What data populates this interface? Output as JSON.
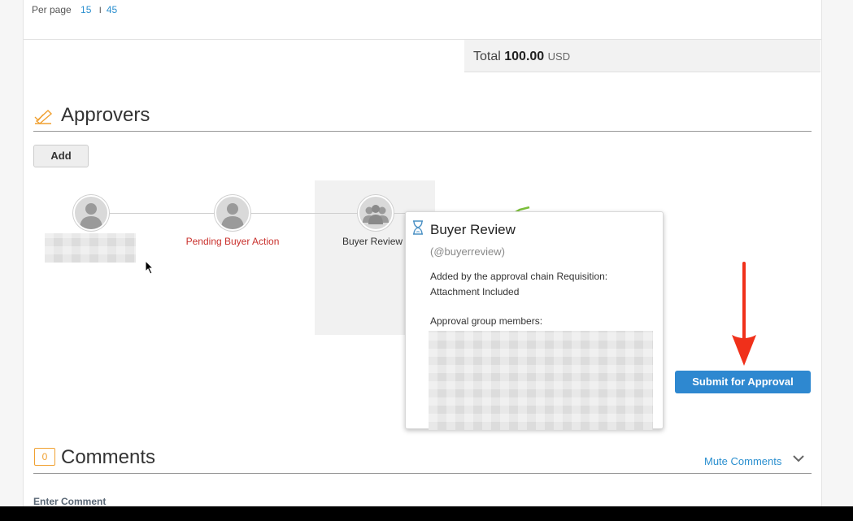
{
  "pagination": {
    "label": "Per page",
    "option_1": "15",
    "separator": "I",
    "option_2": "45"
  },
  "total": {
    "label": "Total",
    "amount": "100.00",
    "currency": "USD"
  },
  "approvers": {
    "title": "Approvers",
    "add_label": "Add",
    "chain": [
      {
        "name": "",
        "status": "",
        "icon": "user-icon"
      },
      {
        "name": "Pending Buyer Action",
        "status": "pending",
        "icon": "user-icon"
      },
      {
        "name": "Buyer Review",
        "status": "",
        "icon": "group-icon"
      }
    ]
  },
  "popup": {
    "icon": "hourglass-icon",
    "title": "Buyer Review",
    "handle": "(@buyerreview)",
    "description": "Added by the approval chain Requisition: Attachment Included",
    "members_label": "Approval group members:"
  },
  "submit_label": "Submit for Approval",
  "comments": {
    "count": "0",
    "title": "Comments",
    "mute_label": "Mute Comments",
    "enter_label": "Enter Comment"
  },
  "colors": {
    "accent": "#2e88d0",
    "pending": "#c9302c",
    "link": "#2a8fcf",
    "annotation_arrow": "#f0301a"
  }
}
